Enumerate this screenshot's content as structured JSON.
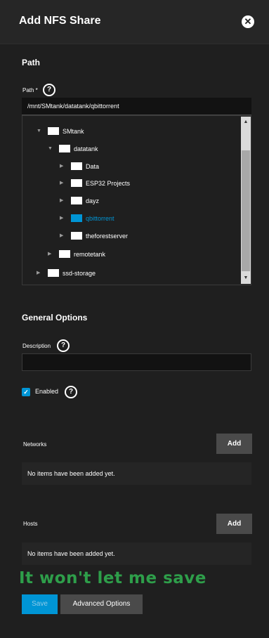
{
  "dialog": {
    "title": "Add NFS Share",
    "close_icon": "close-icon",
    "close_glyph": "✕"
  },
  "path_section": {
    "title": "Path",
    "field_label": "Path *",
    "help_glyph": "?",
    "value": "/mnt/SMtank/datatank/qbittorrent"
  },
  "tree": {
    "nodes": [
      {
        "label": "SMtank",
        "expanded": true,
        "selected": false
      },
      {
        "label": "datatank",
        "expanded": true,
        "selected": false
      },
      {
        "label": "Data",
        "expanded": false,
        "selected": false
      },
      {
        "label": "ESP32 Projects",
        "expanded": false,
        "selected": false
      },
      {
        "label": "dayz",
        "expanded": false,
        "selected": false
      },
      {
        "label": "qbittorrent",
        "expanded": false,
        "selected": true
      },
      {
        "label": "theforestserver",
        "expanded": false,
        "selected": false
      },
      {
        "label": "remotetank",
        "expanded": false,
        "selected": false
      },
      {
        "label": "ssd-storage",
        "expanded": false,
        "selected": false
      }
    ],
    "expanded_glyph": "▼",
    "collapsed_glyph": "▶",
    "scroll_up_glyph": "▲",
    "scroll_down_glyph": "▼"
  },
  "general": {
    "title": "General Options",
    "description_label": "Description",
    "description_value": "",
    "help_glyph": "?",
    "enabled_label": "Enabled",
    "enabled_checked": true,
    "check_glyph": "✓"
  },
  "networks": {
    "label": "Networks",
    "add_label": "Add",
    "empty_text": "No items have been added yet."
  },
  "hosts": {
    "label": "Hosts",
    "add_label": "Add",
    "empty_text": "No items have been added yet."
  },
  "annotation": {
    "text": "It won't let me save",
    "color": "#2e9e4a"
  },
  "footer": {
    "save_label": "Save",
    "advanced_label": "Advanced Options"
  },
  "colors": {
    "accent": "#0095d5",
    "background": "#1f1f1f",
    "button_gray": "#4a4a4a"
  }
}
